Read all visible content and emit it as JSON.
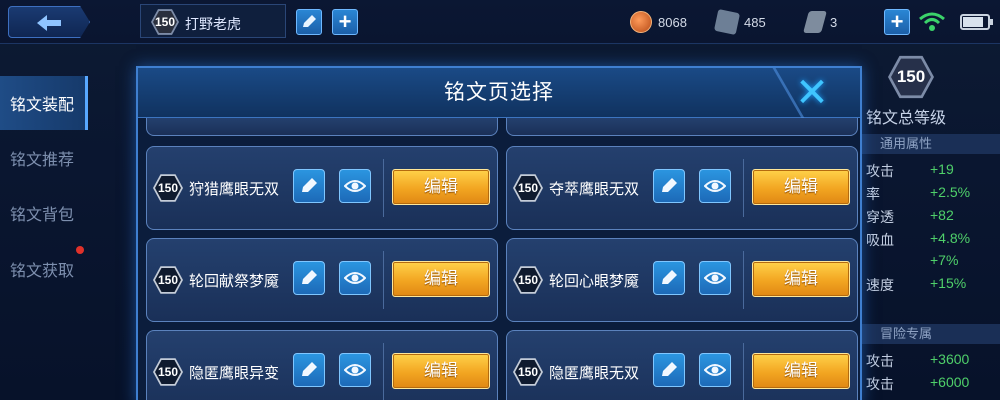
{
  "topbar": {
    "player_level": "150",
    "player_name": "打野老虎",
    "currencies": [
      {
        "icon": "gold-coin-icon",
        "value": "8068"
      },
      {
        "icon": "diamond-icon",
        "value": "485"
      },
      {
        "icon": "voucher-icon",
        "value": "3"
      }
    ],
    "battery_level": 0.85
  },
  "sidebar": {
    "items": [
      {
        "label": "铭文装配",
        "active": true
      },
      {
        "label": "铭文推荐",
        "active": false
      },
      {
        "label": "铭文背包",
        "active": false
      },
      {
        "label": "铭文获取",
        "active": false,
        "badge": "red-dot"
      }
    ]
  },
  "stats_panel": {
    "total_level": "150",
    "title": "铭文总等级",
    "section_general": "通用属性",
    "general": [
      {
        "name": "攻击",
        "value": "+19"
      },
      {
        "name": "率",
        "value": "+2.5%"
      },
      {
        "name": "穿透",
        "value": "+82"
      },
      {
        "name": "吸血",
        "value": "+4.8%"
      },
      {
        "name": "",
        "value": "+7%"
      },
      {
        "name": "速度",
        "value": "+15%"
      }
    ],
    "section_adventure": "冒险专属",
    "adventure": [
      {
        "name": "攻击",
        "value": "+3600"
      },
      {
        "name": "攻击",
        "value": "+6000"
      }
    ]
  },
  "modal": {
    "title": "铭文页选择",
    "edit_label": "编辑",
    "pages": [
      {
        "level": "150",
        "name": "狩猎鹰眼无双"
      },
      {
        "level": "150",
        "name": "夺萃鹰眼无双"
      },
      {
        "level": "150",
        "name": "轮回献祭梦魇"
      },
      {
        "level": "150",
        "name": "轮回心眼梦魇"
      },
      {
        "level": "150",
        "name": "隐匿鹰眼异变"
      },
      {
        "level": "150",
        "name": "隐匿鹰眼无双"
      }
    ]
  },
  "colors": {
    "accent_blue": "#3fc5ff",
    "edit_button_gold": "#f2a521",
    "stat_green": "#4fd06a"
  }
}
